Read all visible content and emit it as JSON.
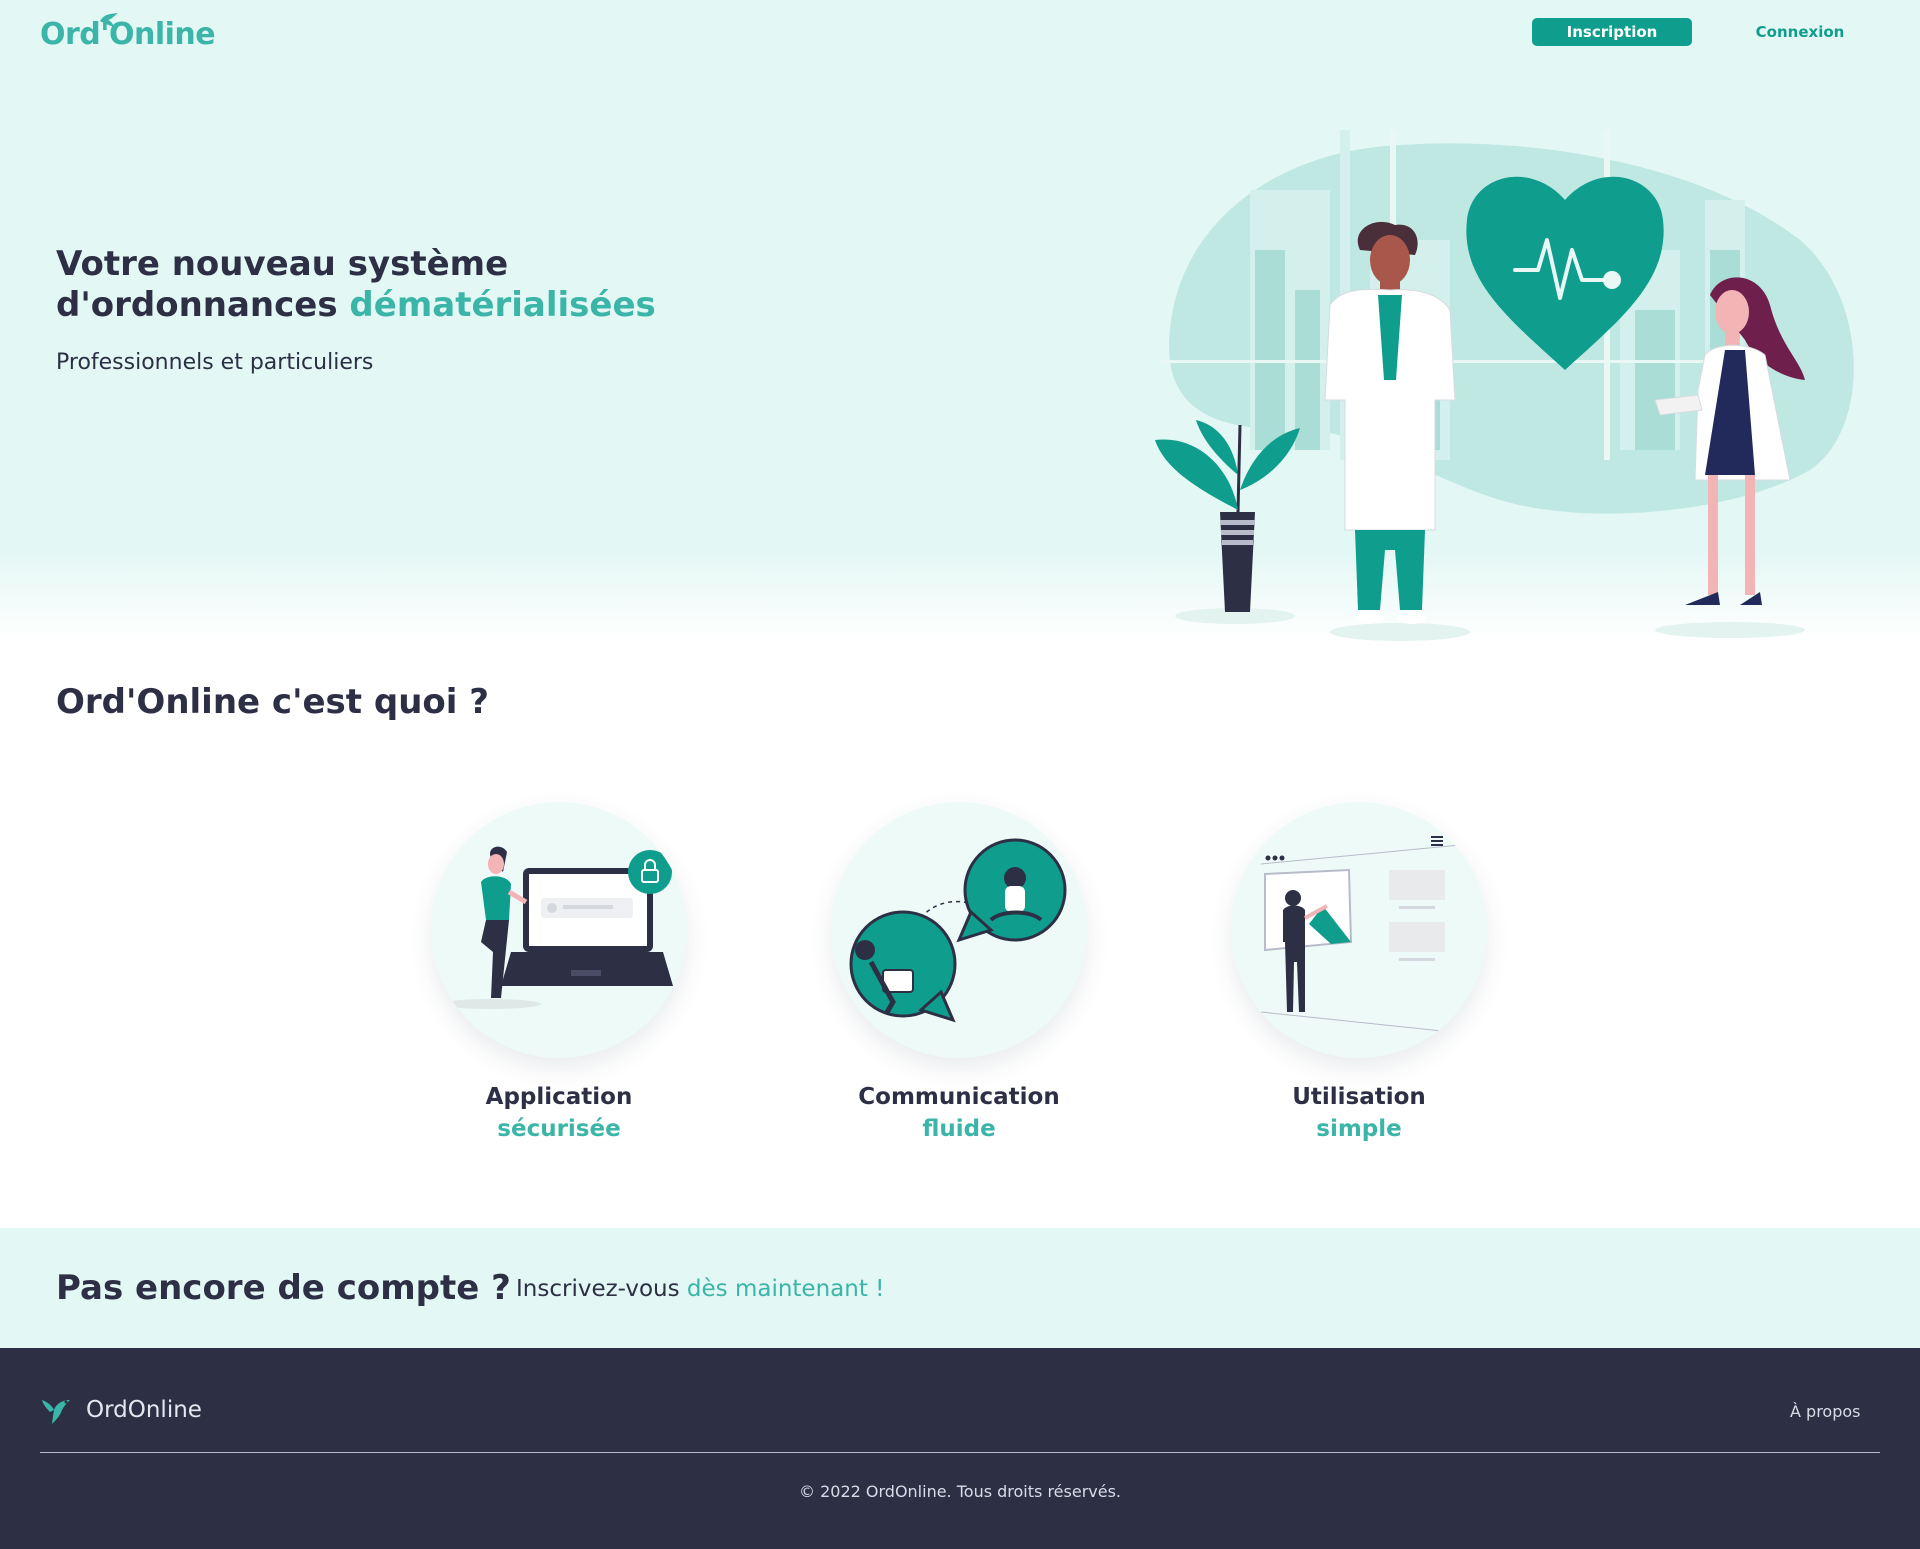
{
  "header": {
    "logo_text": "Ord'Online",
    "signup_label": "Inscription",
    "login_label": "Connexion"
  },
  "hero": {
    "title_line1": "Votre nouveau système",
    "title_line2_prefix": "d'ordonnances ",
    "title_line2_accent": "dématérialisées",
    "subtitle": "Professionnels et particuliers"
  },
  "about": {
    "title": "Ord'Online c'est quoi ?",
    "features": [
      {
        "title": "Application",
        "subtitle": "sécurisée",
        "icon": "secure-laptop-illustration"
      },
      {
        "title": "Communication",
        "subtitle": "fluide",
        "icon": "chat-bubbles-illustration"
      },
      {
        "title": "Utilisation",
        "subtitle": "simple",
        "icon": "presentation-board-illustration"
      }
    ]
  },
  "cta": {
    "title": "Pas encore de compte ?",
    "text_prefix": "Inscrivez-vous ",
    "link_text": "dès maintenant !"
  },
  "footer": {
    "logo_text": "OrdOnline",
    "about_link": "À propos",
    "copyright": "© 2022 OrdOnline. Tous droits réservés."
  },
  "colors": {
    "accent": "#3ab5a7",
    "button": "#0f9e8e",
    "dark": "#2d2f45",
    "light_bg": "#e3f7f4"
  }
}
